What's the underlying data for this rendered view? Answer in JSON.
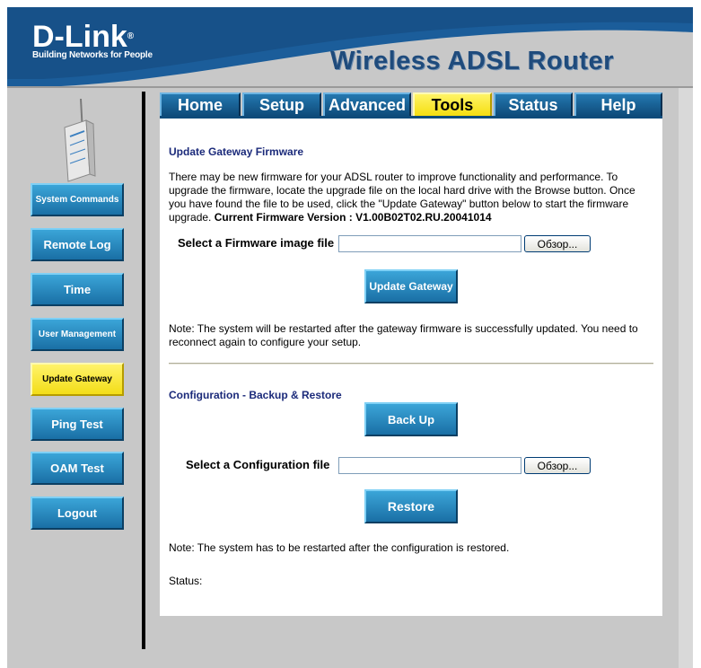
{
  "header": {
    "brand": "D-Link",
    "registered": "®",
    "tagline": "Building Networks for People",
    "product_title": "Wireless ADSL Router"
  },
  "tabs": [
    {
      "label": "Home",
      "active": false
    },
    {
      "label": "Setup",
      "active": false
    },
    {
      "label": "Advanced",
      "active": false
    },
    {
      "label": "Tools",
      "active": true
    },
    {
      "label": "Status",
      "active": false
    },
    {
      "label": "Help",
      "active": false
    }
  ],
  "sidebar": {
    "device_icon": "router-device-icon",
    "items": [
      {
        "label": "System Commands",
        "active": false
      },
      {
        "label": "Remote Log",
        "active": false
      },
      {
        "label": "Time",
        "active": false
      },
      {
        "label": "User Management",
        "active": false
      },
      {
        "label": "Update Gateway",
        "active": true
      },
      {
        "label": "Ping Test",
        "active": false
      },
      {
        "label": "OAM Test",
        "active": false
      },
      {
        "label": "Logout",
        "active": false
      }
    ]
  },
  "firmware": {
    "title": "Update Gateway Firmware",
    "description": "There may be new firmware for your ADSL router to improve functionality and performance. To upgrade the firmware, locate the upgrade file on the local hard drive with the Browse button. Once you have found the file to be used, click the \"Update Gateway\" button below to start the firmware upgrade.",
    "version_label": "Current Firmware Version :",
    "version_value": "V1.00B02T02.RU.20041014",
    "file_label": "Select a Firmware image file",
    "file_value": "",
    "browse_label": "Обзор...",
    "update_button": "Update Gateway",
    "note": "Note: The system will be restarted after the gateway firmware is successfully updated. You need to reconnect again to configure your setup."
  },
  "config": {
    "title": "Configuration - Backup & Restore",
    "backup_button": "Back Up",
    "file_label": "Select a Configuration file",
    "file_value": "",
    "browse_label": "Обзор...",
    "restore_button": "Restore",
    "note": "Note: The system has to be restarted after the configuration is restored.",
    "status_label": "Status:"
  },
  "colors": {
    "button_blue": "#1a6fa5",
    "active_yellow": "#f3dd17",
    "header_blue": "#1f4b7c",
    "sidebar_grey": "#c8c8c8"
  }
}
